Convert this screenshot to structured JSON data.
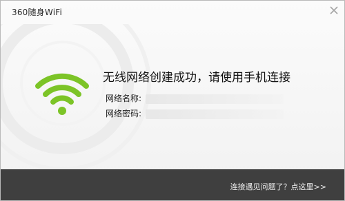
{
  "window": {
    "title": "360随身WiFi"
  },
  "main": {
    "headline": "无线网络创建成功，请使用手机连接",
    "network_name_label": "网络名称:",
    "network_name_value": "",
    "password_label": "网络密码:",
    "password_value": ""
  },
  "footer": {
    "help_link": "连接遇见问题了？点这里>>"
  },
  "icons": {
    "wifi": "wifi-icon",
    "close": "close-icon"
  },
  "colors": {
    "wifi_green": "#7cc427",
    "footer_bg": "#3f3f3f"
  }
}
